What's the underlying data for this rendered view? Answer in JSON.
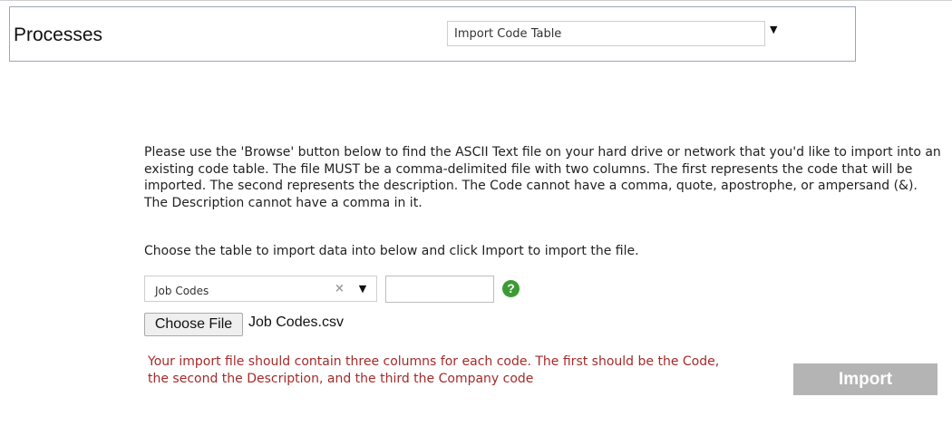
{
  "header": {
    "title": "Processes",
    "process_select": {
      "selected": "Import Code Table",
      "arrow_icon": "triangle-down-icon"
    }
  },
  "main": {
    "instructions": "Please use the 'Browse' button below to find the ASCII Text file on your hard drive or network that you'd like to import into an existing code table. The file MUST be a comma-delimited file with two columns. The first represents the code that will be imported. The second represents the description. The Code cannot have a comma, quote, apostrophe, or ampersand (&). The Description cannot have a comma in it.",
    "choose_text": "Choose the table to import data into below and click Import to import the file.",
    "table_select": {
      "selected": "Job Codes",
      "clear_icon": "close-icon",
      "arrow_icon": "triangle-down-icon"
    },
    "code_input": {
      "value": "",
      "placeholder": ""
    },
    "help_icon": {
      "glyph": "?",
      "color": "#3d9b35"
    },
    "file_picker": {
      "button_label": "Choose File",
      "file_name": "Job Codes.csv"
    },
    "warning": "Your import file should contain three columns for each code. The first should be the Code, the second the Description, and the third the Company code",
    "import_button": "Import"
  },
  "colors": {
    "warning_text": "#a52a2a",
    "import_button_bg": "#b4b4b4",
    "header_border": "#9aa7b5"
  }
}
